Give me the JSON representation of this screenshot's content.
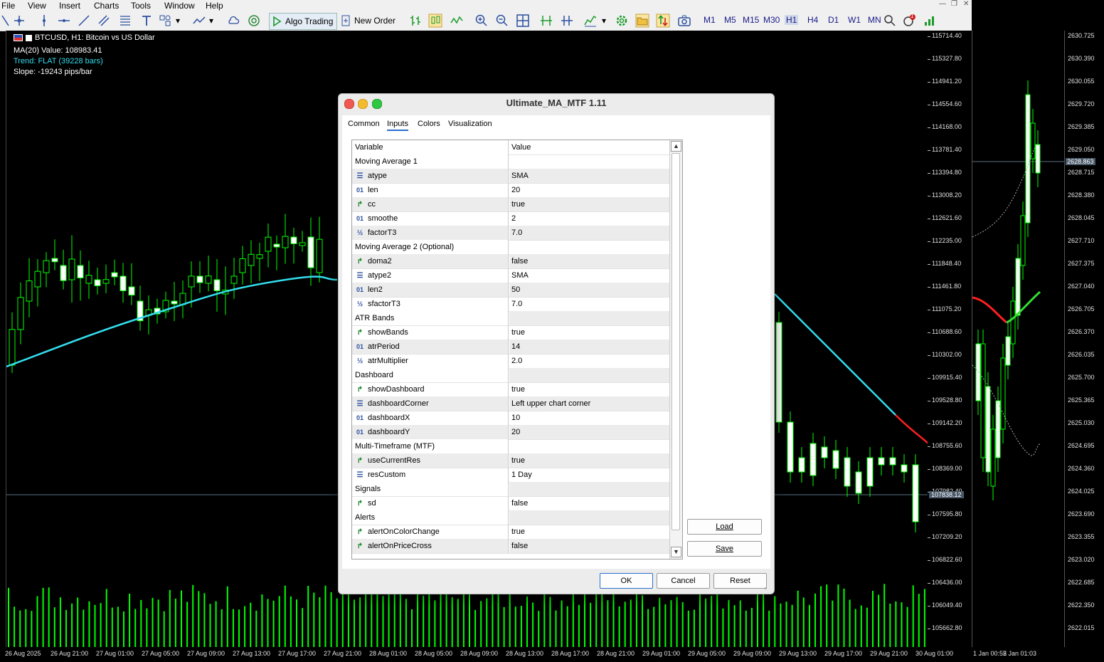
{
  "menubar": {
    "items": [
      "File",
      "View",
      "Insert",
      "Charts",
      "Tools",
      "Window",
      "Help"
    ]
  },
  "toolbar": {
    "algo_trading": "Algo Trading",
    "new_order": "New Order",
    "timeframes": [
      "M1",
      "M5",
      "M15",
      "M30",
      "H1",
      "H4",
      "D1",
      "W1",
      "MN"
    ],
    "active_timeframe": "H1",
    "notification_count": "1"
  },
  "chart": {
    "symbol_title": "BTCUSD, H1:  Bitcoin vs US Dollar",
    "ma_value": "MA(20) Value: 108983.41",
    "trend": "Trend: FLAT (39228 bars)",
    "slope": "Slope: -19243 pips/bar",
    "current_price": "107838.12",
    "price_labels": [
      "115714.40",
      "115327.80",
      "114941.20",
      "114554.60",
      "114168.00",
      "113781.40",
      "113394.80",
      "113008.20",
      "112621.60",
      "112235.00",
      "111848.40",
      "111461.80",
      "111075.20",
      "110688.60",
      "110302.00",
      "109915.40",
      "109528.80",
      "109142.20",
      "108755.60",
      "108369.00",
      "107982.40",
      "107595.80",
      "107209.20",
      "106822.60",
      "106436.00",
      "106049.40",
      "105662.80"
    ],
    "time_labels": [
      "26 Aug 2025",
      "26 Aug 21:00",
      "27 Aug 01:00",
      "27 Aug 05:00",
      "27 Aug 09:00",
      "27 Aug 13:00",
      "27 Aug 17:00",
      "27 Aug 21:00",
      "28 Aug 01:00",
      "28 Aug 05:00",
      "28 Aug 09:00",
      "28 Aug 13:00",
      "28 Aug 17:00",
      "28 Aug 21:00",
      "29 Aug 01:00",
      "29 Aug 05:00",
      "29 Aug 09:00",
      "29 Aug 13:00",
      "29 Aug 17:00",
      "29 Aug 21:00",
      "30 Aug 01:00"
    ],
    "colors": {
      "candle_up": "#00ff00",
      "ma_line": "#33ddee",
      "ma_down": "#ff2020",
      "ma_up": "#33dd33"
    }
  },
  "side_chart": {
    "current_price": "2628.863",
    "price_labels": [
      "2630.725",
      "2630.390",
      "2630.055",
      "2629.720",
      "2629.385",
      "2629.050",
      "2628.715",
      "2628.380",
      "2628.045",
      "2627.710",
      "2627.375",
      "2627.040",
      "2626.705",
      "2626.370",
      "2626.035",
      "2625.700",
      "2625.365",
      "2625.030",
      "2624.695",
      "2624.360",
      "2624.025",
      "2623.690",
      "2623.355",
      "2623.020",
      "2622.685",
      "2622.350",
      "2622.015"
    ],
    "time_labels": [
      "1 Jan 00:55",
      "2 Jan 01:03"
    ]
  },
  "dialog": {
    "title": "Ultimate_MA_MTF 1.11",
    "tabs": [
      "Common",
      "Inputs",
      "Colors",
      "Visualization"
    ],
    "active_tab": "Inputs",
    "columns": [
      "Variable",
      "Value"
    ],
    "rows": [
      {
        "kind": "group",
        "name": "Moving Average 1",
        "value": ""
      },
      {
        "kind": "enum",
        "name": "atype",
        "value": "SMA"
      },
      {
        "kind": "int",
        "name": "len",
        "value": "20"
      },
      {
        "kind": "bool",
        "name": "cc",
        "value": "true"
      },
      {
        "kind": "int",
        "name": "smoothe",
        "value": "2"
      },
      {
        "kind": "dbl",
        "name": "factorT3",
        "value": "7.0"
      },
      {
        "kind": "group",
        "name": "Moving Average 2 (Optional)",
        "value": ""
      },
      {
        "kind": "bool",
        "name": "doma2",
        "value": "false"
      },
      {
        "kind": "enum",
        "name": "atype2",
        "value": "SMA"
      },
      {
        "kind": "int",
        "name": "len2",
        "value": "50"
      },
      {
        "kind": "dbl",
        "name": "sfactorT3",
        "value": "7.0"
      },
      {
        "kind": "group",
        "name": "ATR Bands",
        "value": ""
      },
      {
        "kind": "bool",
        "name": "showBands",
        "value": "true"
      },
      {
        "kind": "int",
        "name": "atrPeriod",
        "value": "14"
      },
      {
        "kind": "dbl",
        "name": "atrMultiplier",
        "value": "2.0"
      },
      {
        "kind": "group",
        "name": "Dashboard",
        "value": ""
      },
      {
        "kind": "bool",
        "name": "showDashboard",
        "value": "true"
      },
      {
        "kind": "enum",
        "name": "dashboardCorner",
        "value": "Left upper chart corner"
      },
      {
        "kind": "int",
        "name": "dashboardX",
        "value": "10"
      },
      {
        "kind": "int",
        "name": "dashboardY",
        "value": "20"
      },
      {
        "kind": "group",
        "name": "Multi-Timeframe (MTF)",
        "value": ""
      },
      {
        "kind": "bool",
        "name": "useCurrentRes",
        "value": "true"
      },
      {
        "kind": "enum",
        "name": "resCustom",
        "value": "1 Day"
      },
      {
        "kind": "group",
        "name": "Signals",
        "value": ""
      },
      {
        "kind": "bool",
        "name": "sd",
        "value": "false"
      },
      {
        "kind": "group",
        "name": "Alerts",
        "value": ""
      },
      {
        "kind": "bool",
        "name": "alertOnColorChange",
        "value": "true"
      },
      {
        "kind": "bool",
        "name": "alertOnPriceCross",
        "value": "false"
      }
    ],
    "load_label": "Load",
    "save_label": "Save",
    "ok_label": "OK",
    "cancel_label": "Cancel",
    "reset_label": "Reset"
  }
}
